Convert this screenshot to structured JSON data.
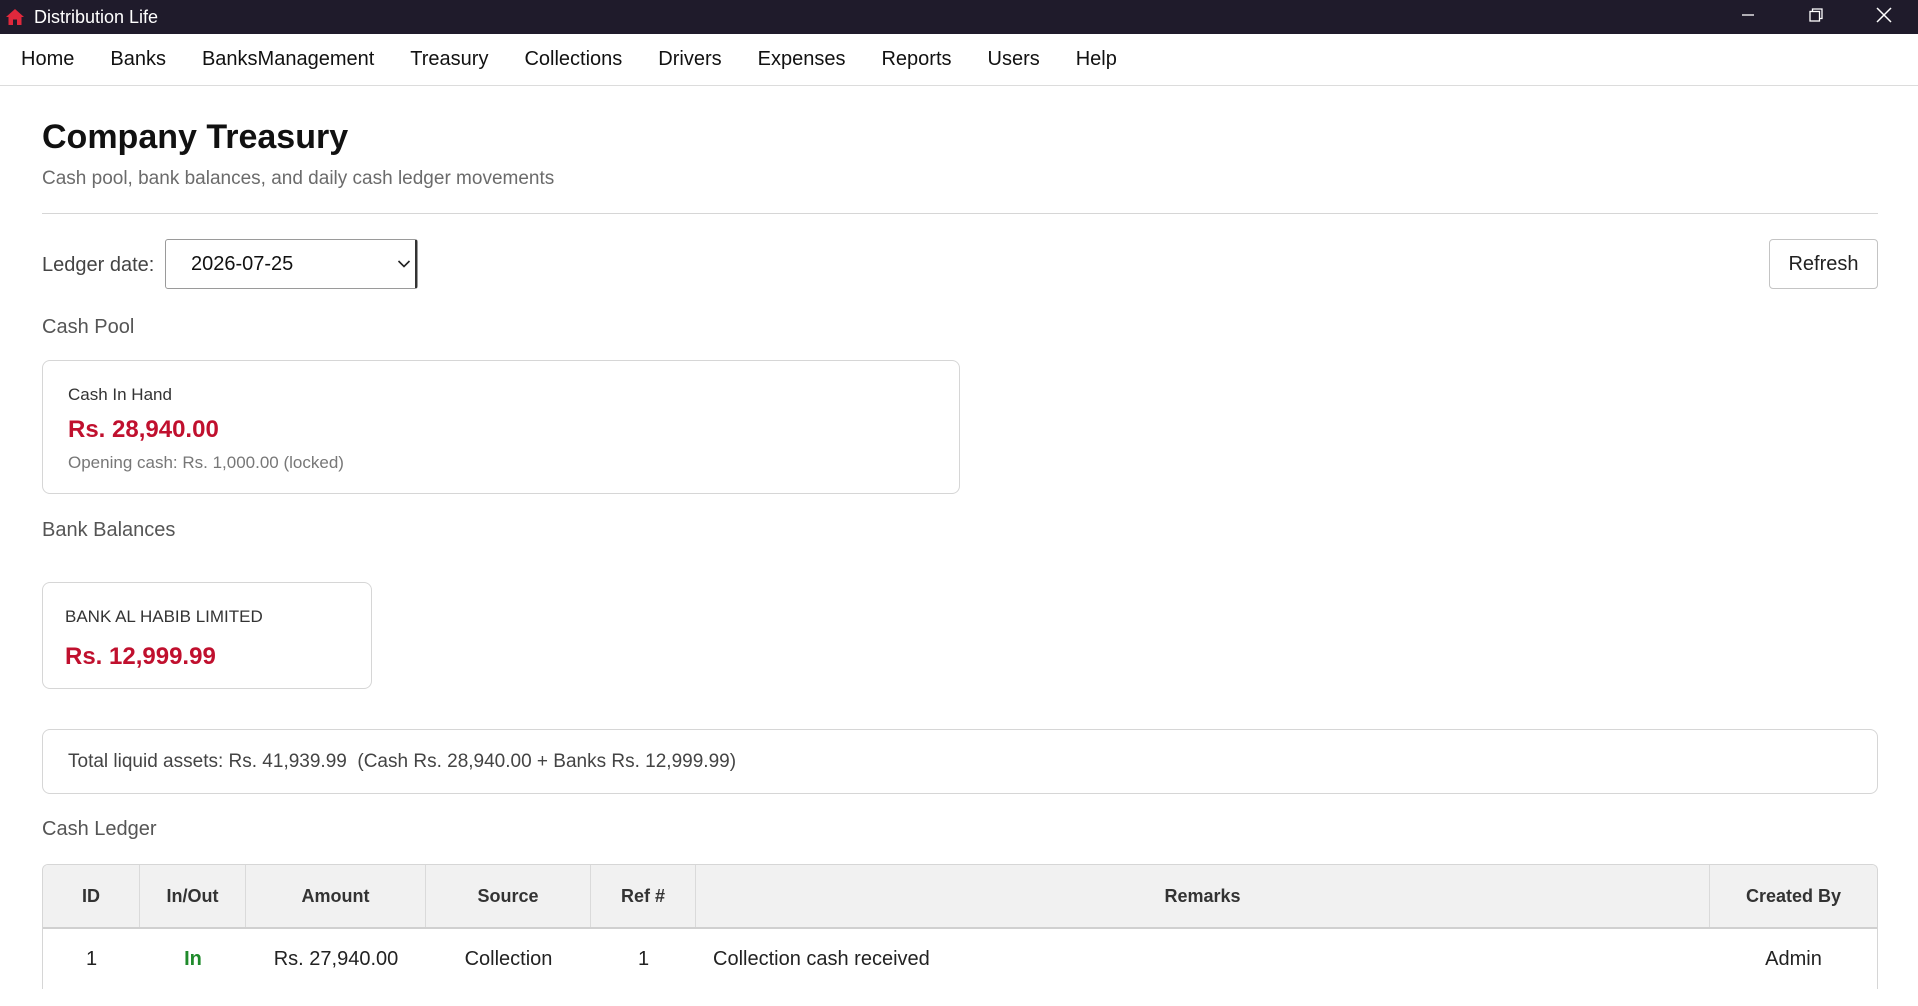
{
  "window": {
    "title": "Distribution Life",
    "icons": {
      "app": "home-icon",
      "minimize": "minimize-icon",
      "restore": "restore-icon",
      "close": "close-icon"
    }
  },
  "menu": [
    "Home",
    "Banks",
    "BanksManagement",
    "Treasury",
    "Collections",
    "Drivers",
    "Expenses",
    "Reports",
    "Users",
    "Help"
  ],
  "header": {
    "title": "Company Treasury",
    "subtitle": "Cash pool, bank balances, and daily cash ledger movements"
  },
  "controls": {
    "ledger_label": "Ledger date:",
    "ledger_date": "2026-07-25",
    "refresh_label": "Refresh"
  },
  "cash_pool": {
    "section_label": "Cash Pool",
    "card_title": "Cash In Hand",
    "amount": "Rs. 28,940.00",
    "note": "Opening cash: Rs. 1,000.00 (locked)"
  },
  "bank_balances": {
    "section_label": "Bank Balances",
    "banks": [
      {
        "name": "BANK AL HABIB LIMITED",
        "amount": "Rs. 12,999.99"
      }
    ]
  },
  "summary": {
    "text": "Total liquid assets: Rs. 41,939.99  (Cash Rs. 28,940.00 + Banks Rs. 12,999.99)"
  },
  "cash_ledger": {
    "section_label": "Cash Ledger",
    "columns": [
      "ID",
      "In/Out",
      "Amount",
      "Source",
      "Ref #",
      "Remarks",
      "Created By"
    ],
    "rows": [
      {
        "id": "1",
        "inout": "In",
        "amount": "Rs. 27,940.00",
        "source": "Collection",
        "ref": "1",
        "remarks": "Collection cash received",
        "created_by": "Admin"
      }
    ]
  },
  "colors": {
    "titlebar": "#1f1b2b",
    "amount_red": "#c0102e",
    "in_green": "#1f8a2b",
    "app_icon_red": "#e0283c"
  }
}
